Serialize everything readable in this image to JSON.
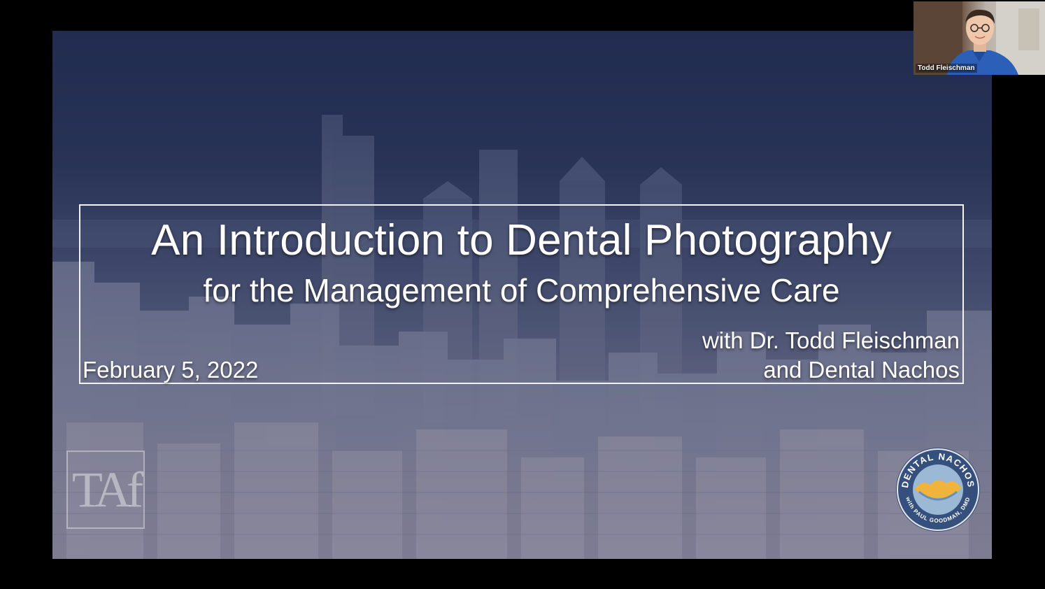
{
  "slide": {
    "title": "An Introduction to Dental Photography",
    "subtitle": "for the Management of Comprehensive Care",
    "presenter_line1": "with Dr. Todd Fleischman",
    "presenter_line2": "and Dental Nachos",
    "date": "February 5, 2022",
    "logo_left": "TAf",
    "logo_right_top": "DENTAL NACHOS",
    "logo_right_bottom": "with PAUL GOODMAN, DMD"
  },
  "participant": {
    "name": "Todd Fleischman"
  },
  "colors": {
    "frame_border": "#f2f2f2",
    "slide_tint": "#2c3856",
    "badge_blue": "#2d4a7a",
    "badge_gold": "#f0b43c"
  }
}
